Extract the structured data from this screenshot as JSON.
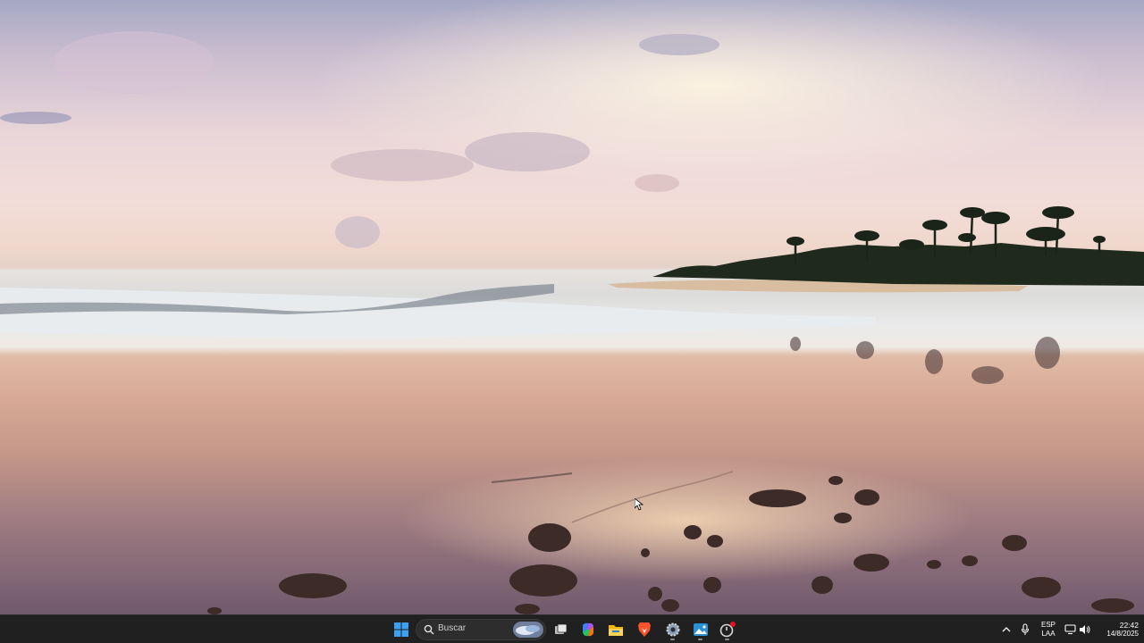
{
  "taskbar": {
    "search_placeholder": "Buscar",
    "language_line1": "ESP",
    "language_line2": "LAA",
    "clock_time": "22:42",
    "clock_date": "14/8/2025"
  },
  "icons": {
    "start": "windows-start-icon",
    "search": "search-icon",
    "task_view": "task-view-icon",
    "copilot": "copilot-icon",
    "explorer": "file-explorer-icon",
    "brave": "brave-browser-icon",
    "settings": "settings-gear-icon",
    "photos": "photos-icon",
    "app": "app-icon-with-notification"
  },
  "colors": {
    "taskbar_bg": "#202020",
    "start_blue": "#3ea0f2"
  }
}
